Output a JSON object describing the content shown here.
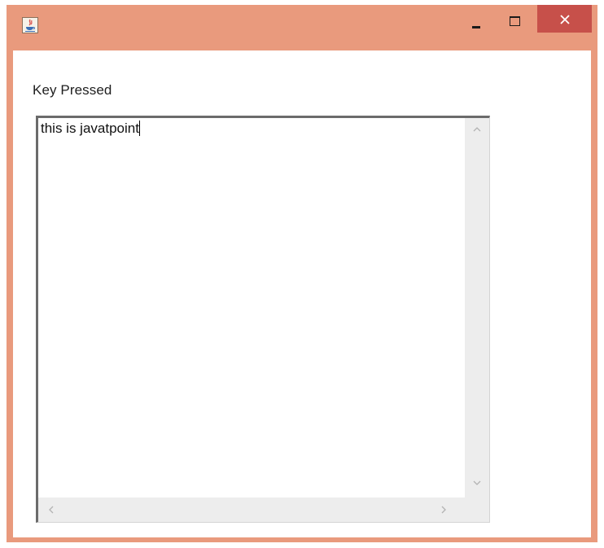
{
  "window": {
    "title": "",
    "frame_color": "#e99a7d",
    "close_color": "#c7504a",
    "icons": {
      "app": "java-app-icon",
      "minimize": "minimize-icon",
      "maximize": "maximize-icon",
      "close": "close-icon"
    }
  },
  "content": {
    "label": "Key Pressed",
    "textarea": {
      "value": "this is javatpoint"
    },
    "scrollbar_icons": {
      "up": "chevron-up-icon",
      "down": "chevron-down-icon",
      "left": "chevron-left-icon",
      "right": "chevron-right-icon"
    }
  }
}
